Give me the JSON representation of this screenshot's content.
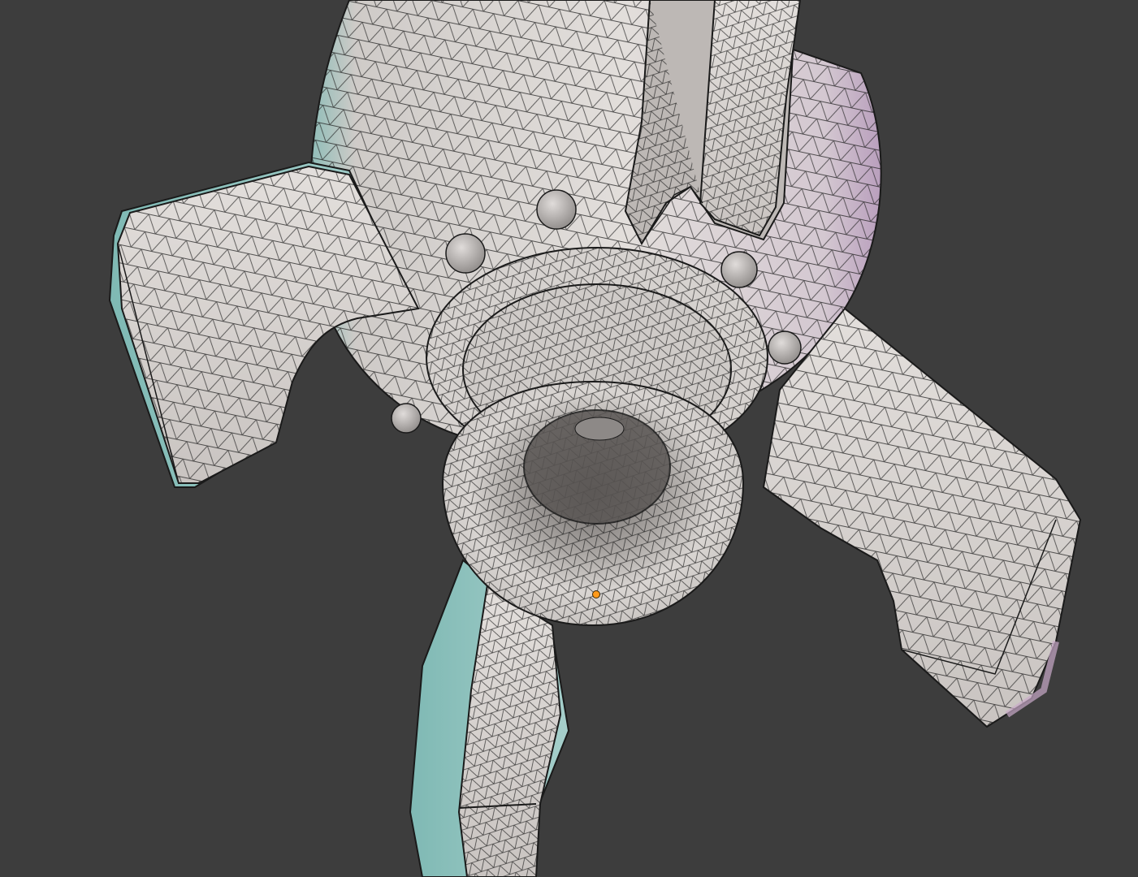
{
  "viewport": {
    "background": "#3d3d3d",
    "shading": "solid-wireframe-overlay",
    "surface_color": "#d8d4d1",
    "edge_color": "#1a1a1a",
    "rim_tint_cyan": "#7fb9b4",
    "rim_tint_pink": "#caa6c6",
    "origin_color": "#ff9a1a"
  },
  "scene": {
    "object": "rocket-mesh",
    "parts": [
      "rocket-body",
      "fin-left",
      "fin-right",
      "fin-bottom",
      "fin-top",
      "engine-mount",
      "nozzle",
      "rivets",
      "origin-point"
    ]
  }
}
